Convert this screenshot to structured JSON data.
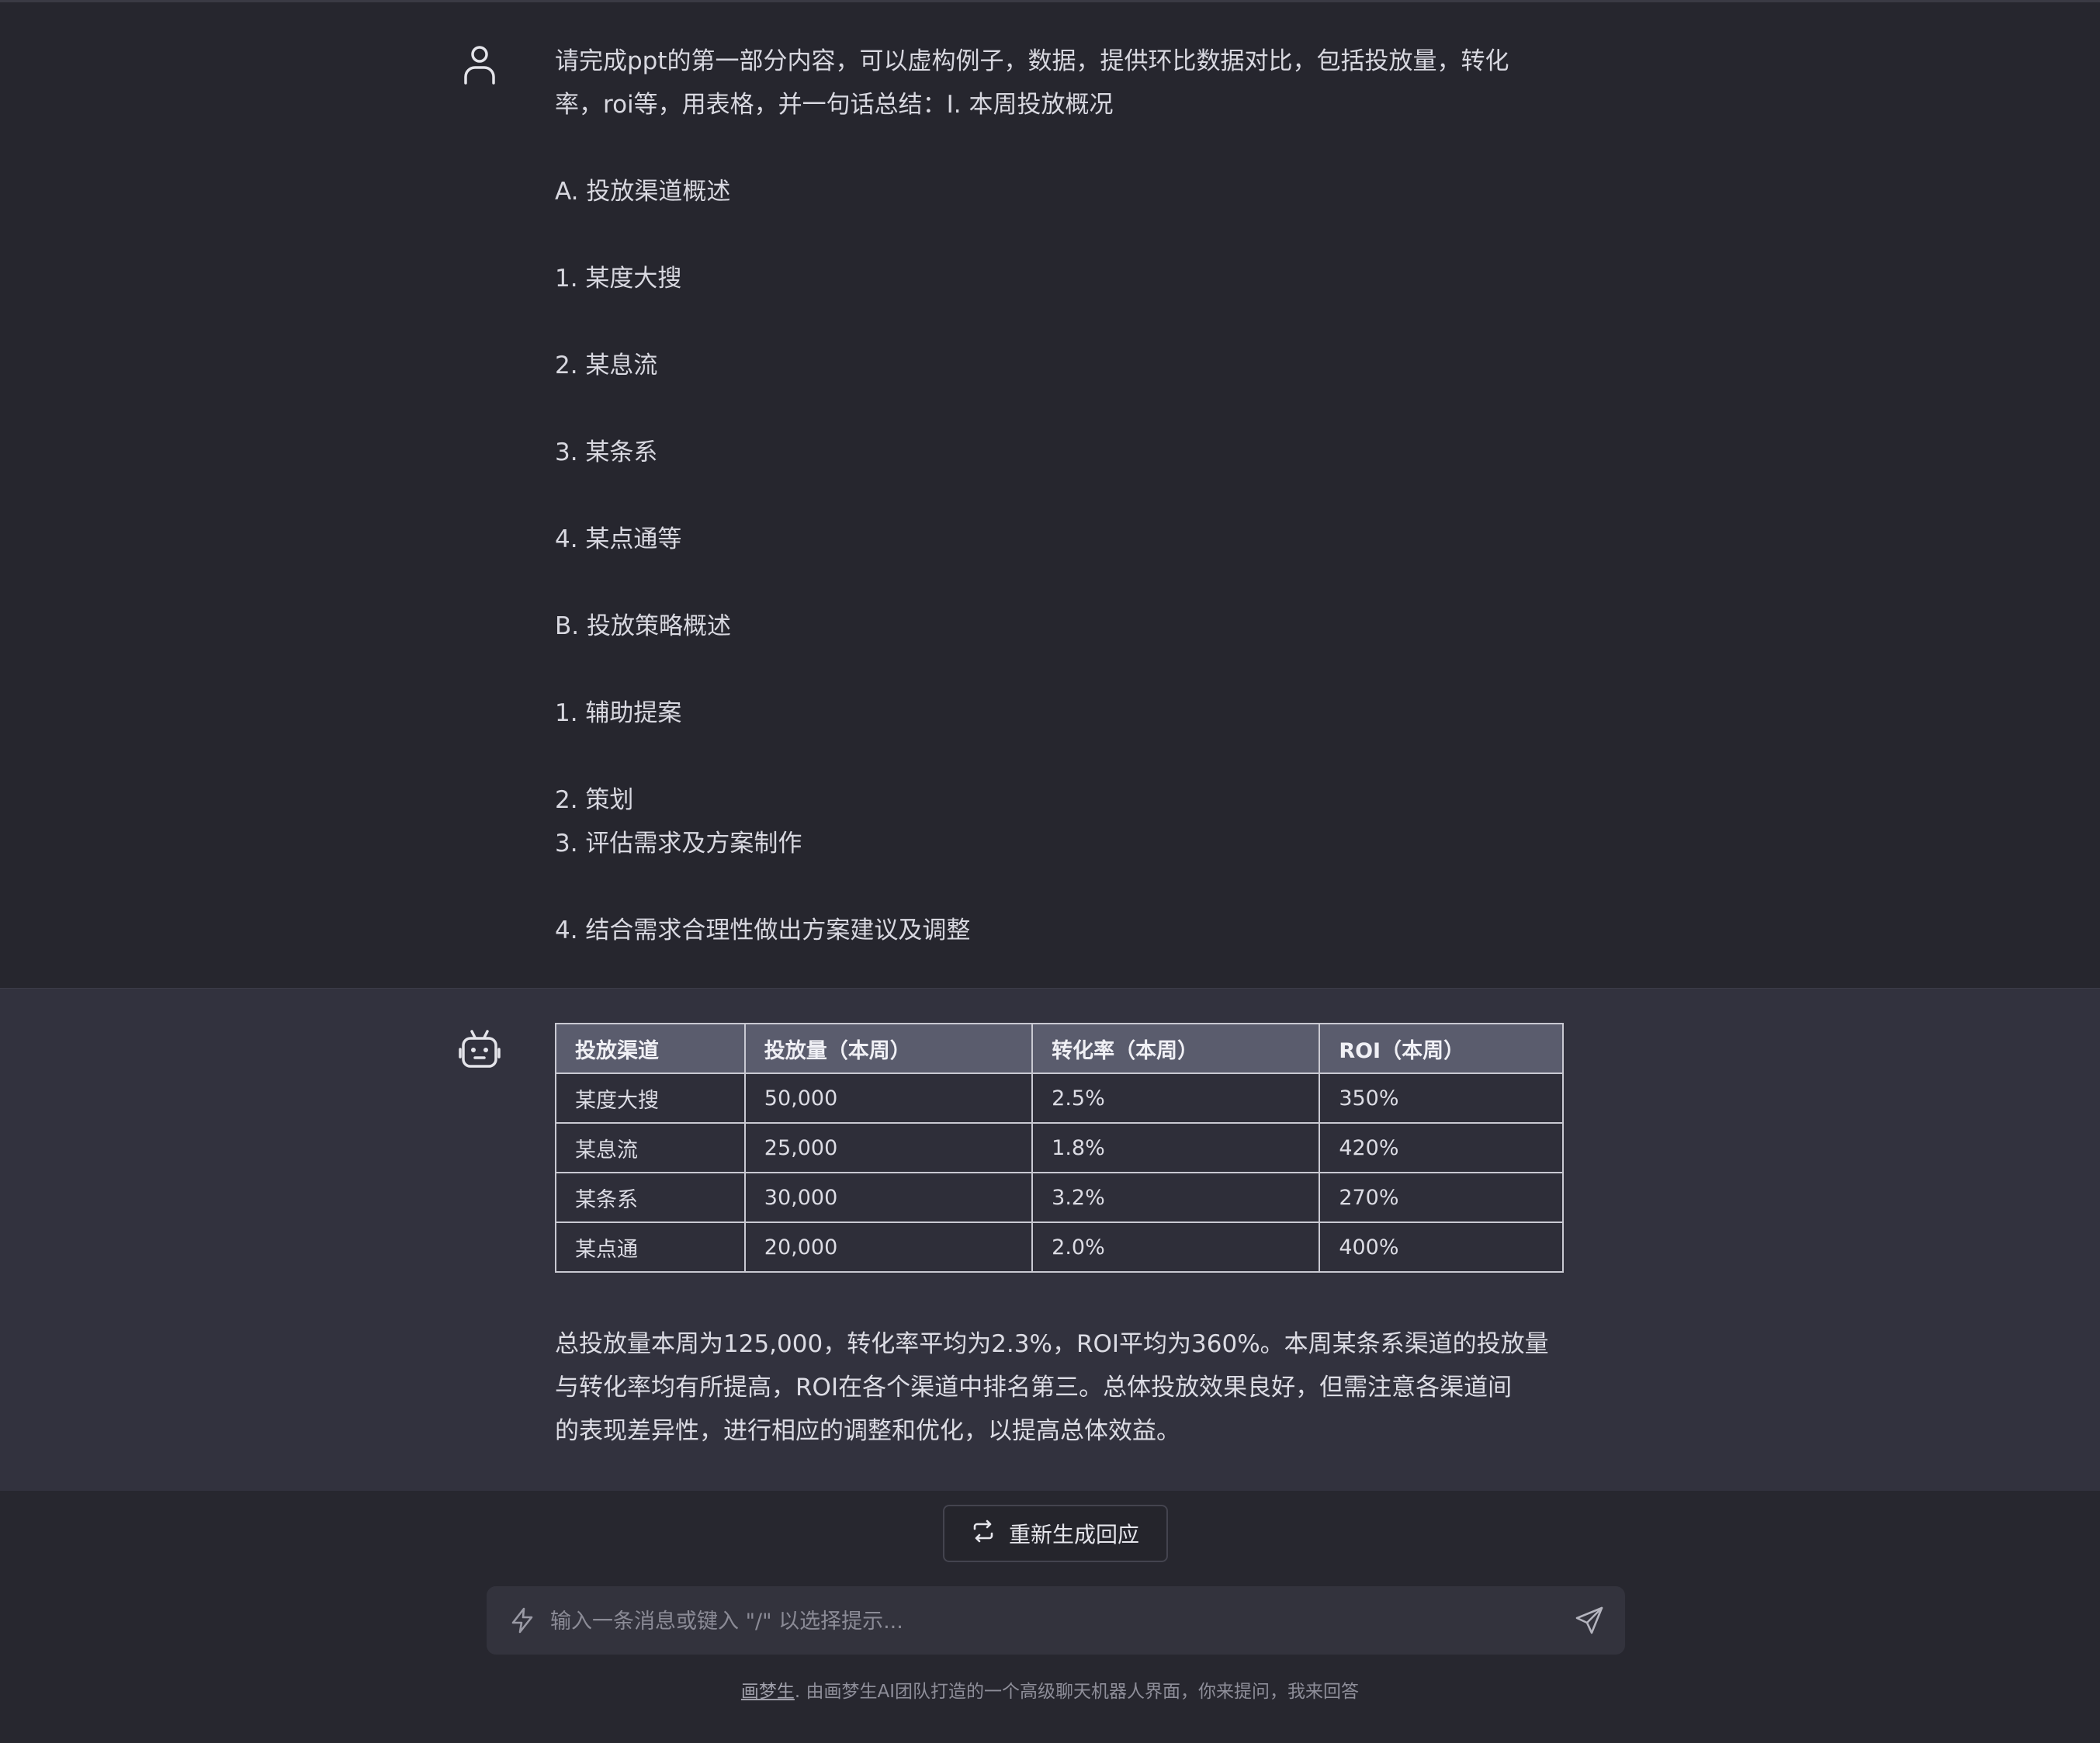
{
  "user_message": {
    "lines": [
      "请完成ppt的第一部分内容，可以虚构例子，数据，提供环比数据对比，包括投放量，转化",
      "率，roi等，用表格，并一句话总结：I. 本周投放概况",
      "A. 投放渠道概述",
      "1. 某度大搜",
      "2. 某息流",
      "3. 某条系",
      "4. 某点通等",
      "B. 投放策略概述",
      "1. 辅助提案",
      "2. 策划",
      "3. 评估需求及方案制作",
      "4. 结合需求合理性做出方案建议及调整"
    ]
  },
  "assistant_message": {
    "table": {
      "headers": [
        "投放渠道",
        "投放量（本周）",
        "转化率（本周）",
        "ROI（本周）"
      ],
      "rows": [
        [
          "某度大搜",
          "50,000",
          "2.5%",
          "350%"
        ],
        [
          "某息流",
          "25,000",
          "1.8%",
          "420%"
        ],
        [
          "某条系",
          "30,000",
          "3.2%",
          "270%"
        ],
        [
          "某点通",
          "20,000",
          "2.0%",
          "400%"
        ]
      ]
    },
    "summary_lines": [
      "总投放量本周为125,000，转化率平均为2.3%，ROI平均为360%。本周某条系渠道的投放量",
      "与转化率均有所提高，ROI在各个渠道中排名第三。总体投放效果良好，但需注意各渠道间",
      "的表现差异性，进行相应的调整和优化，以提高总体效益。"
    ]
  },
  "regenerate_label": "重新生成回应",
  "input": {
    "placeholder": "输入一条消息或键入 \"/\" 以选择提示..."
  },
  "footer": {
    "link_text": "画梦生",
    "text": ". 由画梦生AI团队打造的一个高级聊天机器人界面，你来提问，我来回答"
  }
}
